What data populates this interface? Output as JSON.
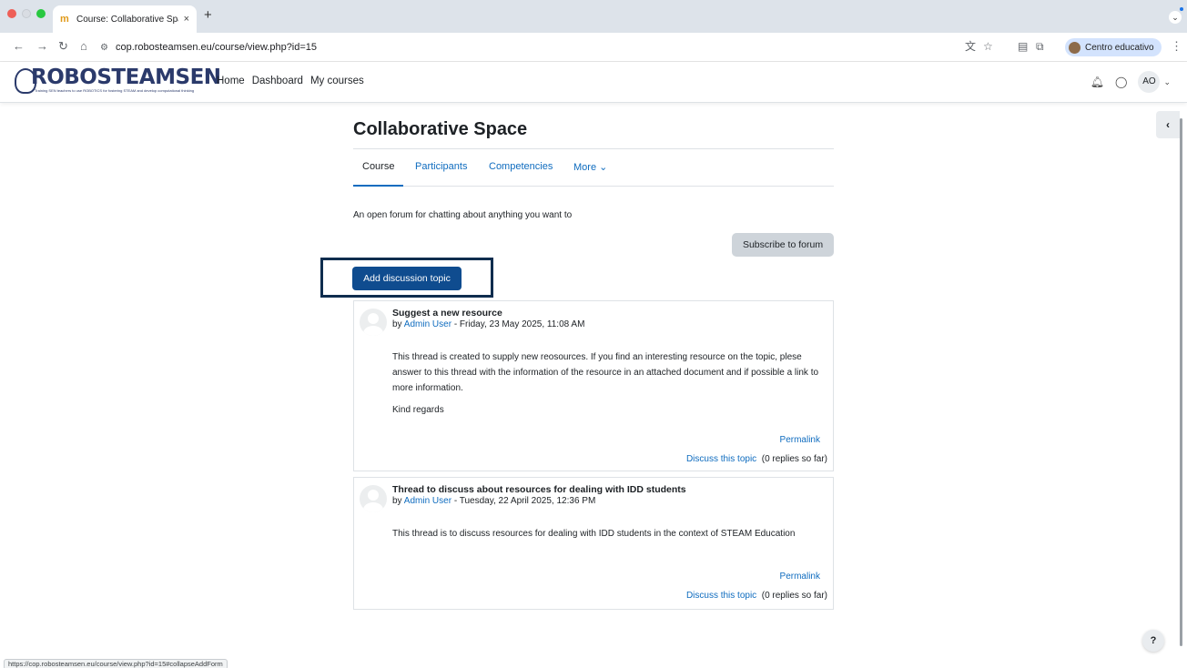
{
  "browser": {
    "tab_title": "Course: Collaborative Space",
    "tab_close": "×",
    "new_tab": "+",
    "url": "cop.robosteamsen.eu/course/view.php?id=15",
    "profile_name": "Centro educativo",
    "status_url": "https://cop.robosteamsen.eu/course/view.php?id=15#collapseAddForm"
  },
  "navbar": {
    "logo_text": "ROBOSTEAMSEN",
    "logo_tagline": "Training SEN teachers to use ROBOTICS for fostering STEAM and develop computational thinking",
    "links": [
      "Home",
      "Dashboard",
      "My courses"
    ],
    "user_initials": "AO"
  },
  "page": {
    "title": "Collaborative Space",
    "tabs": [
      "Course",
      "Participants",
      "Competencies",
      "More ⌄"
    ],
    "intro": "An open forum for chatting about anything you want to",
    "subscribe_label": "Subscribe to forum",
    "add_topic_label": "Add discussion topic"
  },
  "posts": [
    {
      "subject": "Suggest a new resource",
      "by": "by ",
      "author": "Admin User",
      "date": " - Friday, 23 May 2025, 11:08 AM",
      "body": "This thread is created to supply new reosources. If you find an interesting resource on the topic, plese answer to this thread with the information of the resource in an attached document and if possible a link to more information.",
      "body2": "Kind regards",
      "permalink": "Permalink",
      "discuss": "Discuss this topic",
      "replies": "(0 replies so far)"
    },
    {
      "subject": "Thread to discuss about resources for dealing with IDD students",
      "by": "by ",
      "author": "Admin User",
      "date": " - Tuesday, 22 April 2025, 12:36 PM",
      "body": "This thread is to discuss resources for dealing with IDD students in the context of STEAM Education",
      "permalink": "Permalink",
      "discuss": "Discuss this topic",
      "replies": "(0 replies so far)"
    }
  ],
  "help_label": "?",
  "colors": {
    "primary": "#0f6cbf",
    "add_button": "#0f4c8f",
    "highlight_box": "#0f2d4e"
  }
}
